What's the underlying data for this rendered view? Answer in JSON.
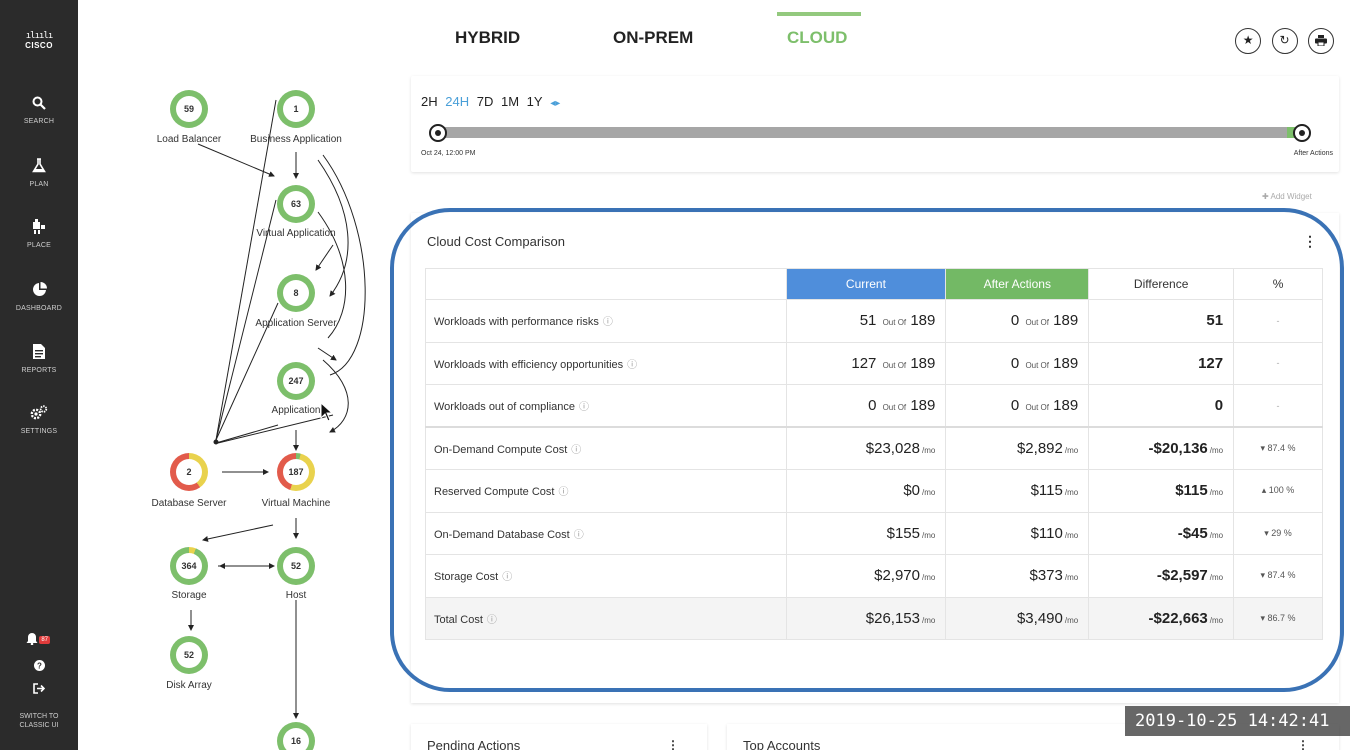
{
  "sidebar": {
    "logo": {
      "bars": "ılıılı",
      "text": "CISCO"
    },
    "items": [
      {
        "label": "SEARCH",
        "icon": "search-icon"
      },
      {
        "label": "PLAN",
        "icon": "flask-icon"
      },
      {
        "label": "PLACE",
        "icon": "place-icon"
      },
      {
        "label": "DASHBOARD",
        "icon": "pie-chart-icon"
      },
      {
        "label": "REPORTS",
        "icon": "document-icon"
      },
      {
        "label": "SETTINGS",
        "icon": "gears-icon"
      }
    ],
    "notification_count": "87",
    "switch_label": "SWITCH TO CLASSIC UI"
  },
  "tabs": [
    {
      "label": "HYBRID",
      "active": false
    },
    {
      "label": "ON-PREM",
      "active": false
    },
    {
      "label": "CLOUD",
      "active": true
    }
  ],
  "top_actions": [
    "star-icon",
    "refresh-icon",
    "print-icon"
  ],
  "topology": {
    "nodes": [
      {
        "value": "59",
        "label": "Load Balancer",
        "color": "#7dbf6b"
      },
      {
        "value": "1",
        "label": "Business Application",
        "color": "#7dbf6b"
      },
      {
        "value": "63",
        "label": "Virtual Application",
        "color": "#7dbf6b"
      },
      {
        "value": "8",
        "label": "Application Server",
        "color": "#7dbf6b"
      },
      {
        "value": "247",
        "label": "Application",
        "color": "#7dbf6b"
      },
      {
        "value": "2",
        "label": "Database Server",
        "color": "#e25b4b"
      },
      {
        "value": "187",
        "label": "Virtual Machine",
        "color": "#e9d24d"
      },
      {
        "value": "364",
        "label": "Storage",
        "color": "#7dbf6b"
      },
      {
        "value": "52",
        "label": "Host",
        "color": "#7dbf6b"
      },
      {
        "value": "52",
        "label": "Disk Array",
        "color": "#7dbf6b"
      },
      {
        "value": "16",
        "label": "",
        "color": "#7dbf6b"
      }
    ]
  },
  "time_range": {
    "options": [
      "2H",
      "24H",
      "7D",
      "1M",
      "1Y"
    ],
    "active": "24H",
    "start_label": "Oct 24, 12:00 PM",
    "end_label": "After Actions"
  },
  "add_widget_label": "✚ Add Widget",
  "cost_card": {
    "title": "Cloud Cost Comparison",
    "headers": {
      "current": "Current",
      "after": "After Actions",
      "difference": "Difference",
      "percent": "%"
    },
    "colors": {
      "current": "#4f8edb",
      "after": "#73b965"
    },
    "out_of": "Out Of",
    "per_mo": "/mo",
    "rows": [
      {
        "metric": "Workloads with performance risks",
        "current": "51",
        "current_total": "189",
        "after": "0",
        "after_total": "189",
        "difference": "51",
        "pct": "-"
      },
      {
        "metric": "Workloads with efficiency opportunities",
        "current": "127",
        "current_total": "189",
        "after": "0",
        "after_total": "189",
        "difference": "127",
        "pct": "-"
      },
      {
        "metric": "Workloads out of compliance",
        "current": "0",
        "current_total": "189",
        "after": "0",
        "after_total": "189",
        "difference": "0",
        "pct": "-"
      },
      {
        "metric": "On-Demand Compute Cost",
        "current": "$23,028",
        "after": "$2,892",
        "difference": "-$20,136",
        "pct": "▾ 87.4 %"
      },
      {
        "metric": "Reserved Compute Cost",
        "current": "$0",
        "after": "$115",
        "difference": "$115",
        "pct": "▴ 100 %"
      },
      {
        "metric": "On-Demand Database Cost",
        "current": "$155",
        "after": "$110",
        "difference": "-$45",
        "pct": "▾ 29 %"
      },
      {
        "metric": "Storage Cost",
        "current": "$2,970",
        "after": "$373",
        "difference": "-$2,597",
        "pct": "▾ 87.4 %"
      },
      {
        "metric": "Total Cost",
        "current": "$26,153",
        "after": "$3,490",
        "difference": "-$22,663",
        "pct": "▾ 86.7 %"
      }
    ]
  },
  "bottom_cards": {
    "pending": "Pending Actions",
    "accounts": "Top Accounts"
  },
  "timestamp": "2019-10-25 14:42:41"
}
